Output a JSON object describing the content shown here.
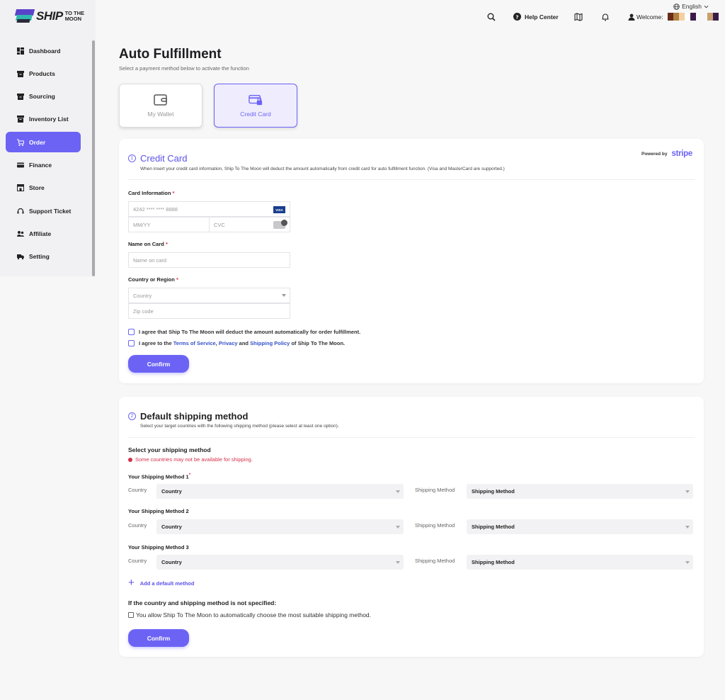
{
  "brand": {
    "word": "SHIP",
    "small_line1": "TO THE",
    "small_line2": "MOON"
  },
  "sidebar": {
    "items": [
      {
        "label": "Dashboard",
        "icon": "dashboard-icon"
      },
      {
        "label": "Products",
        "icon": "box-icon"
      },
      {
        "label": "Sourcing",
        "icon": "box-icon"
      },
      {
        "label": "Inventory List",
        "icon": "archive-icon"
      },
      {
        "label": "Order",
        "icon": "cart-icon",
        "active": true
      },
      {
        "label": "Finance",
        "icon": "card-icon"
      },
      {
        "label": "Store",
        "icon": "store-icon"
      },
      {
        "label": "Support Ticket",
        "icon": "headset-icon"
      },
      {
        "label": "Affiliate",
        "icon": "users-icon"
      },
      {
        "label": "Setting",
        "icon": "truck-icon"
      }
    ]
  },
  "topbar": {
    "language": "English",
    "help_center": "Help Center",
    "welcome": "Welcome:"
  },
  "colors": {
    "accent": "#6c63f5",
    "danger": "#d6304a",
    "link": "#3652c9"
  },
  "page": {
    "title": "Auto Fulfillment",
    "subtitle": "Select a payment method below to activate the function"
  },
  "payment_methods": {
    "wallet": "My Wallet",
    "credit": "Credit Card"
  },
  "credit_section": {
    "number": "1",
    "title": "Credit Card",
    "description": "When insert your credit card information, Ship To The Moon will deduct the amount automatically from credit card for auto fulfillment function. (Visa and MasterCard are supported.)",
    "powered_by": "Powered by",
    "stripe": "stripe",
    "card_info_label": "Card Information",
    "card_number_placeholder": "4242 **** **** 8888",
    "visa": "VISA",
    "expiry_placeholder": "MM/YY",
    "cvc_placeholder": "CVC",
    "name_label": "Name on Card",
    "name_placeholder": "Name on card",
    "country_label": "Country or Region",
    "country_placeholder": "Country",
    "zip_placeholder": "Zip code",
    "agree1": "I agree that Ship To The Moon will deduct the amount automatically for order fulfillment.",
    "agree2_prefix": "I agree to the",
    "agree2_terms": "Terms of Service",
    "agree2_comma": ",",
    "agree2_privacy": "Privacy",
    "agree2_and": "and",
    "agree2_shipping": "Shipping Policy",
    "agree2_suffix": "of Ship To The Moon.",
    "required_mark": "*",
    "confirm": "Confirm"
  },
  "shipping_section": {
    "number": "2",
    "title": "Default shipping method",
    "description": "Select your target countries with the following shipping method (please select at least one option).",
    "heading": "Select your shipping method",
    "warning": "Some countries may not be available for shipping.",
    "country_label": "Country",
    "method_label": "Shipping Method",
    "methods": [
      {
        "title": "Your Shipping Method 1",
        "required": "*",
        "country": "Country",
        "method": "Shipping Method"
      },
      {
        "title": "Your Shipping Method 2",
        "required": "",
        "country": "Country",
        "method": "Shipping Method"
      },
      {
        "title": "Your Shipping Method 3",
        "required": "",
        "country": "Country",
        "method": "Shipping Method"
      }
    ],
    "add_method": "Add a default method",
    "unspecified_heading": "If the country and shipping method is not specified:",
    "allow_text": "You allow Ship To The Moon to automatically choose the most suitable shipping method.",
    "confirm": "Confirm"
  }
}
